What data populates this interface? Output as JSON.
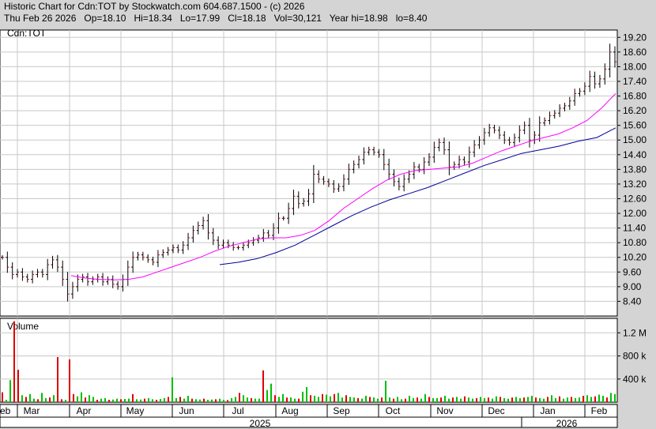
{
  "header": {
    "line1": "Historic Chart for Cdn:TOT by Stockwatch.com 604.687.1500 - (c) 2026",
    "line2": "Thu Feb 26 2026   Op=18.10   Hi=18.34   Lo=17.99   Cl=18.18   Vol=30,121   Year hi=18.98   lo=8.40"
  },
  "colors": {
    "background": "#d4d4d4",
    "plot_bg": "#ffffff",
    "grid": "#c8c8c8",
    "price_bar": "#000000",
    "ma_short": "#ff00ff",
    "ma_long": "#000099",
    "vol_up": "#00c000",
    "vol_down": "#e00000"
  },
  "chart_data": [
    {
      "type": "ohlc",
      "label": "Cdn:TOT",
      "y_axis_side": "right",
      "yticks": [
        "19.20",
        "18.60",
        "18.00",
        "17.40",
        "16.80",
        "16.20",
        "15.60",
        "15.00",
        "14.40",
        "13.80",
        "13.20",
        "12.60",
        "12.00",
        "11.40",
        "10.80",
        "10.20",
        "9.60",
        "9.00",
        "8.40"
      ],
      "ylim": [
        7.8,
        19.5
      ],
      "grid": true,
      "months": [
        {
          "label": "Feb",
          "year": "2025"
        },
        {
          "label": "Mar",
          "year": "2025"
        },
        {
          "label": "Apr",
          "year": "2025"
        },
        {
          "label": "May",
          "year": "2025"
        },
        {
          "label": "Jun",
          "year": "2025"
        },
        {
          "label": "Jul",
          "year": "2025"
        },
        {
          "label": "Aug",
          "year": "2025"
        },
        {
          "label": "Sep",
          "year": "2025"
        },
        {
          "label": "Oct",
          "year": "2025"
        },
        {
          "label": "Nov",
          "year": "2025"
        },
        {
          "label": "Dec",
          "year": "2025"
        },
        {
          "label": "Jan",
          "year": "2026"
        },
        {
          "label": "Feb",
          "year": "2026"
        }
      ],
      "years": [
        {
          "label": "2025"
        },
        {
          "label": "2026"
        }
      ],
      "series": [
        {
          "name": "price_closes",
          "values": [
            10.2,
            9.8,
            9.5,
            9.6,
            9.4,
            9.3,
            9.5,
            9.6,
            9.5,
            9.9,
            10.1,
            9.8,
            9.3,
            8.7,
            9.0,
            9.3,
            9.4,
            9.2,
            9.3,
            9.4,
            9.2,
            9.3,
            9.1,
            9.0,
            9.3,
            9.8,
            10.2,
            10.3,
            10.2,
            10.1,
            10.0,
            10.3,
            10.4,
            10.5,
            10.6,
            10.5,
            10.7,
            11.0,
            11.3,
            11.5,
            11.7,
            11.2,
            10.9,
            10.7,
            10.8,
            10.7,
            10.6,
            10.6,
            10.7,
            10.8,
            10.9,
            11.0,
            11.2,
            11.1,
            11.4,
            11.8,
            11.8,
            12.2,
            12.7,
            12.4,
            12.5,
            12.8,
            13.6,
            13.4,
            13.3,
            13.2,
            13.0,
            13.1,
            13.4,
            13.8,
            14.0,
            14.2,
            14.5,
            14.6,
            14.5,
            14.4,
            14.0,
            13.6,
            13.3,
            13.1,
            13.4,
            13.6,
            13.9,
            13.8,
            14.1,
            14.3,
            14.7,
            14.9,
            14.6,
            13.9,
            14.0,
            14.2,
            14.1,
            14.5,
            14.8,
            15.0,
            15.3,
            15.5,
            15.4,
            15.2,
            15.0,
            14.9,
            15.1,
            15.4,
            15.6,
            15.0,
            15.2,
            15.7,
            15.8,
            16.0,
            16.1,
            16.3,
            16.4,
            16.6,
            16.9,
            17.0,
            17.2,
            17.6,
            17.3,
            17.5,
            17.9,
            18.6,
            18.2
          ]
        },
        {
          "name": "ma_short",
          "values": [
            9.45,
            9.35,
            9.3,
            9.28,
            9.3,
            9.4,
            9.6,
            9.8,
            10.0,
            10.2,
            10.45,
            10.65,
            10.8,
            10.95,
            11.0,
            11.0,
            11.1,
            11.3,
            11.7,
            12.2,
            12.6,
            13.0,
            13.35,
            13.6,
            13.75,
            13.8,
            13.85,
            13.9,
            14.05,
            14.3,
            14.55,
            14.75,
            14.95,
            15.1,
            15.25,
            15.5,
            15.8,
            16.3,
            16.9
          ]
        },
        {
          "name": "ma_long",
          "values": [
            9.9,
            10.0,
            10.15,
            10.4,
            10.7,
            11.1,
            11.5,
            11.9,
            12.25,
            12.55,
            12.8,
            13.05,
            13.35,
            13.65,
            13.95,
            14.2,
            14.45,
            14.6,
            14.75,
            14.95,
            15.1,
            15.5
          ]
        }
      ]
    },
    {
      "type": "bar",
      "label": "Volume",
      "y_axis_side": "right",
      "yticks": [
        "1.2 M",
        "800 k",
        "400 k"
      ],
      "ytick_values": [
        1200000,
        800000,
        400000
      ],
      "ylim": [
        0,
        1450000
      ],
      "grid": true,
      "values": [
        170000,
        40000,
        380000,
        1400000,
        560000,
        120000,
        90000,
        140000,
        60000,
        50000,
        160000,
        70000,
        80000,
        120000,
        780000,
        50000,
        40000,
        740000,
        140000,
        100000,
        170000,
        80000,
        120000,
        90000,
        40000,
        60000,
        70000,
        40000,
        45000,
        60000,
        50000,
        55000,
        60000,
        140000,
        50000,
        45000,
        60000,
        70000,
        50000,
        40000,
        55000,
        70000,
        90000,
        430000,
        70000,
        90000,
        60000,
        110000,
        60000,
        50000,
        45000,
        60000,
        40000,
        45000,
        50000,
        60000,
        40000,
        35000,
        70000,
        90000,
        160000,
        120000,
        80000,
        70000,
        60000,
        60000,
        550000,
        210000,
        320000,
        120000,
        90000,
        140000,
        80000,
        80000,
        60000,
        60000,
        180000,
        260000,
        120000,
        110000,
        90000,
        140000,
        130000,
        100000,
        140000,
        160000,
        80000,
        120000,
        90000,
        80000,
        70000,
        60000,
        110000,
        90000,
        80000,
        60000,
        80000,
        370000,
        80000,
        60000,
        90000,
        50000,
        60000,
        110000,
        70000,
        80000,
        60000,
        140000,
        90000,
        70000,
        70000,
        80000,
        110000,
        60000,
        80000,
        90000,
        60000,
        100000,
        80000,
        60000,
        70000,
        90000,
        70000,
        80000,
        60000,
        100000,
        90000,
        70000,
        60000,
        80000,
        90000,
        70000,
        80000,
        90000,
        110000,
        80000,
        70000,
        60000,
        90000,
        120000,
        70000,
        100000,
        60000,
        80000,
        90000,
        70000,
        80000,
        110000,
        120000,
        90000,
        100000,
        130000,
        110000,
        80000,
        160000,
        140000
      ]
    }
  ]
}
